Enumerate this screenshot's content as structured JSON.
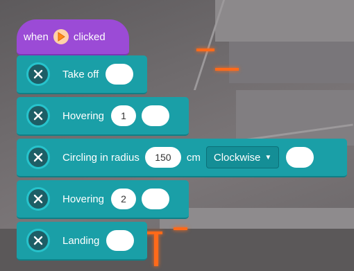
{
  "hat": {
    "when": "when",
    "clicked": "clicked"
  },
  "blocks": [
    {
      "label": "Take off"
    },
    {
      "label": "Hovering",
      "value": "1"
    },
    {
      "label": "Circling in radius",
      "value": "150",
      "unit": "cm",
      "direction": "Clockwise"
    },
    {
      "label": "Hovering",
      "value": "2"
    },
    {
      "label": "Landing"
    }
  ],
  "colors": {
    "hat": "#9b4bd6",
    "block": "#1a9fa7",
    "icon_ring": "#27c3cc",
    "background_glow": "#ff6a1a"
  },
  "icons": {
    "block_icon": "drone-icon",
    "flag_icon": "play-flag-icon"
  }
}
